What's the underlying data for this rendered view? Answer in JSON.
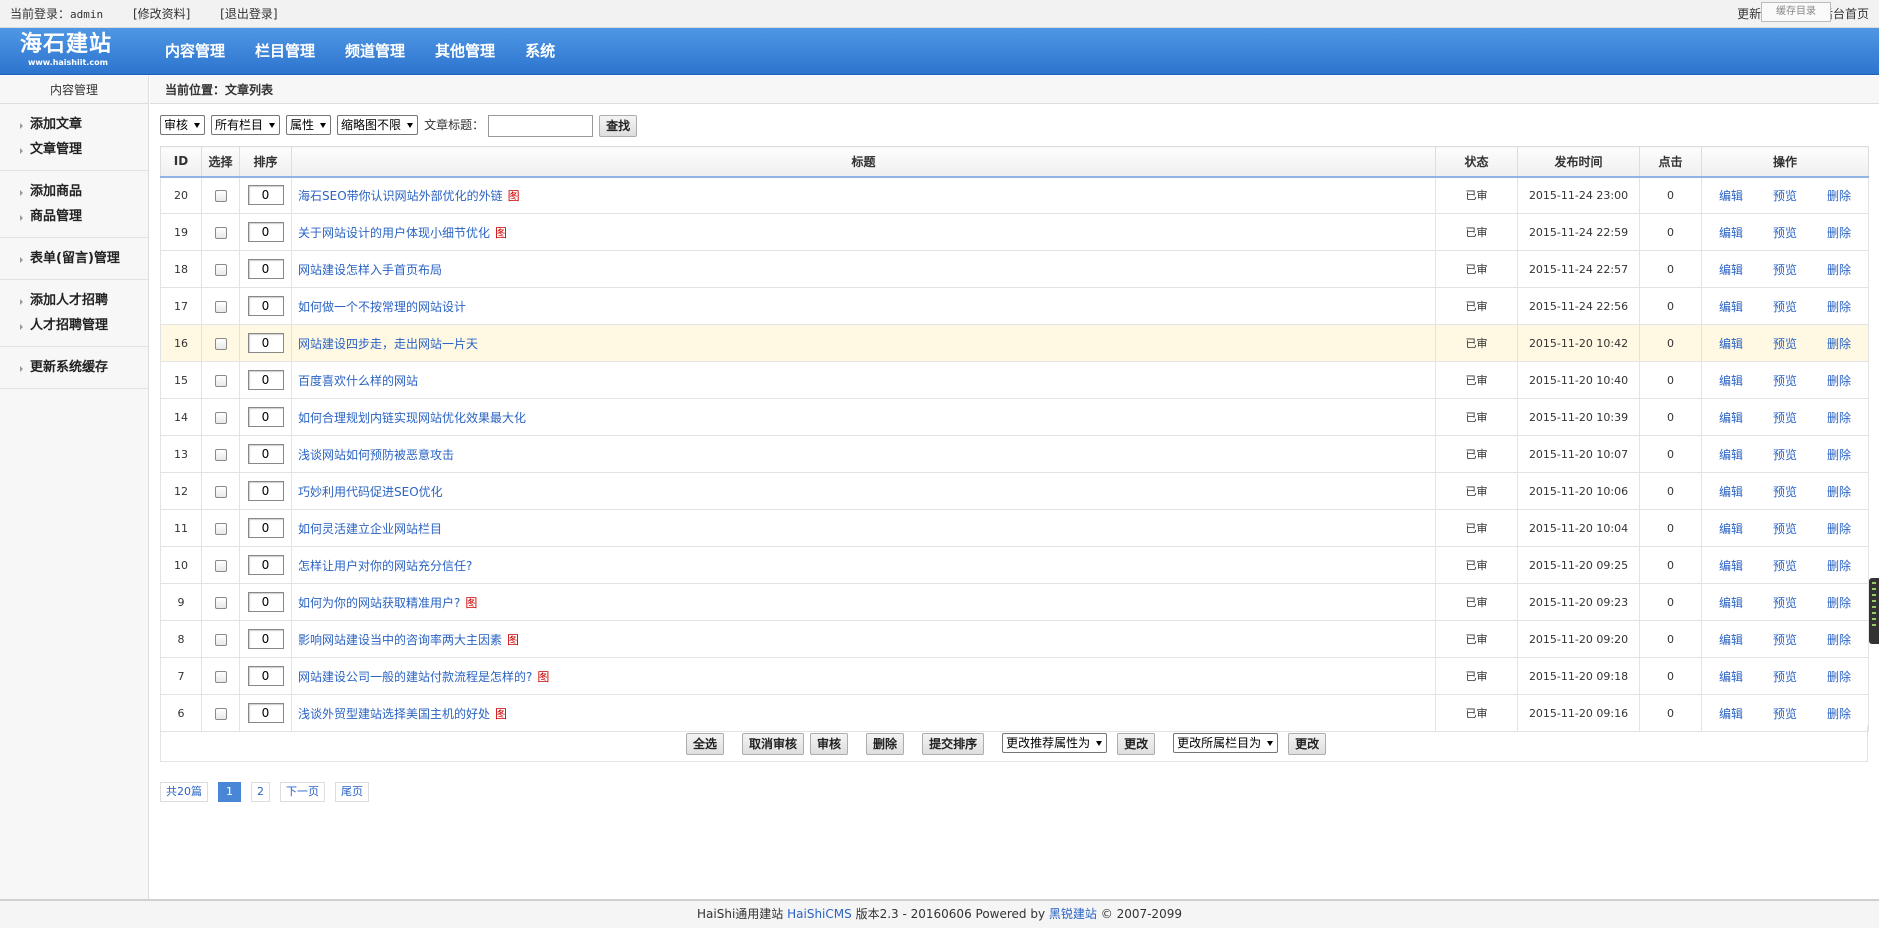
{
  "topbar": {
    "login_label": "当前登录：",
    "user": "admin",
    "edit_profile": "[修改资料]",
    "logout": "[退出登录]",
    "right_cache": "更新系统缓存",
    "right_home": "后台首页",
    "tip": "缓存目录"
  },
  "header": {
    "logo_cn": "海石建站",
    "logo_en": "www.haishiit.com",
    "nav": [
      "内容管理",
      "栏目管理",
      "频道管理",
      "其他管理",
      "系统"
    ]
  },
  "sidebar": {
    "title": "内容管理",
    "groups": [
      [
        "添加文章",
        "文章管理"
      ],
      [
        "添加商品",
        "商品管理"
      ],
      [
        "表单(留言)管理"
      ],
      [
        "添加人才招聘",
        "人才招聘管理"
      ],
      [
        "更新系统缓存"
      ]
    ]
  },
  "breadcrumb": "当前位置：文章列表",
  "filter": {
    "audit": "审核",
    "column": "所有栏目",
    "attr": "属性",
    "thumb": "缩略图不限",
    "title_label": "文章标题：",
    "title_value": "",
    "search": "查找"
  },
  "table": {
    "headers": [
      "ID",
      "选择",
      "排序",
      "标题",
      "状态",
      "发布时间",
      "点击",
      "操作"
    ],
    "op_labels": [
      "编辑",
      "预览",
      "删除"
    ],
    "img_tag": "图",
    "rows": [
      {
        "id": "20",
        "sort": "0",
        "title": "海石SEO带你认识网站外部优化的外链",
        "img": true,
        "status": "已审",
        "time": "2015-11-24 23:00",
        "clicks": "0"
      },
      {
        "id": "19",
        "sort": "0",
        "title": "关于网站设计的用户体现小细节优化",
        "img": true,
        "status": "已审",
        "time": "2015-11-24 22:59",
        "clicks": "0"
      },
      {
        "id": "18",
        "sort": "0",
        "title": "网站建设怎样入手首页布局",
        "img": false,
        "status": "已审",
        "time": "2015-11-24 22:57",
        "clicks": "0"
      },
      {
        "id": "17",
        "sort": "0",
        "title": "如何做一个不按常理的网站设计",
        "img": false,
        "status": "已审",
        "time": "2015-11-24 22:56",
        "clicks": "0"
      },
      {
        "id": "16",
        "sort": "0",
        "title": "网站建设四步走，走出网站一片天",
        "img": false,
        "status": "已审",
        "time": "2015-11-20 10:42",
        "clicks": "0",
        "highlight": true
      },
      {
        "id": "15",
        "sort": "0",
        "title": "百度喜欢什么样的网站",
        "img": false,
        "status": "已审",
        "time": "2015-11-20 10:40",
        "clicks": "0"
      },
      {
        "id": "14",
        "sort": "0",
        "title": "如何合理规划内链实现网站优化效果最大化",
        "img": false,
        "status": "已审",
        "time": "2015-11-20 10:39",
        "clicks": "0"
      },
      {
        "id": "13",
        "sort": "0",
        "title": "浅谈网站如何预防被恶意攻击",
        "img": false,
        "status": "已审",
        "time": "2015-11-20 10:07",
        "clicks": "0"
      },
      {
        "id": "12",
        "sort": "0",
        "title": "巧妙利用代码促进SEO优化",
        "img": false,
        "status": "已审",
        "time": "2015-11-20 10:06",
        "clicks": "0"
      },
      {
        "id": "11",
        "sort": "0",
        "title": "如何灵活建立企业网站栏目",
        "img": false,
        "status": "已审",
        "time": "2015-11-20 10:04",
        "clicks": "0"
      },
      {
        "id": "10",
        "sort": "0",
        "title": "怎样让用户对你的网站充分信任?",
        "img": false,
        "status": "已审",
        "time": "2015-11-20 09:25",
        "clicks": "0"
      },
      {
        "id": "9",
        "sort": "0",
        "title": "如何为你的网站获取精准用户?",
        "img": true,
        "status": "已审",
        "time": "2015-11-20 09:23",
        "clicks": "0"
      },
      {
        "id": "8",
        "sort": "0",
        "title": "影响网站建设当中的咨询率两大主因素",
        "img": true,
        "status": "已审",
        "time": "2015-11-20 09:20",
        "clicks": "0"
      },
      {
        "id": "7",
        "sort": "0",
        "title": "网站建设公司一般的建站付款流程是怎样的?",
        "img": true,
        "status": "已审",
        "time": "2015-11-20 09:18",
        "clicks": "0"
      },
      {
        "id": "6",
        "sort": "0",
        "title": "浅谈外贸型建站选择美国主机的好处",
        "img": true,
        "status": "已审",
        "time": "2015-11-20 09:16",
        "clicks": "0"
      }
    ]
  },
  "actions": {
    "select_all": "全选",
    "unaudit": "取消审核",
    "audit": "审核",
    "delete": "删除",
    "submit_sort": "提交排序",
    "change_recommend": "更改推荐属性为",
    "change_btn": "更改",
    "change_column": "更改所属栏目为",
    "change_btn2": "更改"
  },
  "pager": {
    "total": "共20篇",
    "pages": [
      "1",
      "2"
    ],
    "next": "下一页",
    "last": "尾页"
  },
  "footer": {
    "prefix": "HaiShi通用建站",
    "cms": "HaiShiCMS",
    "version": "版本2.3 - 20160606 Powered by",
    "brand": "黑锐建站",
    "copyright": "© 2007-2099"
  }
}
